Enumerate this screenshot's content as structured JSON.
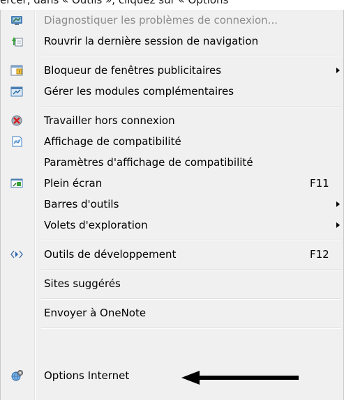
{
  "caption": "ercer, dans « Outils », cliquez sur « Options",
  "menu": {
    "items": [
      {
        "label": "Diagnostiquer les problèmes de connexion...",
        "icon": "network-diagnose-icon",
        "disabled": true
      },
      {
        "label": "Rouvrir la dernière session de navigation",
        "icon": "reopen-session-icon"
      },
      {
        "label": "Bloqueur de fenêtres publicitaires",
        "icon": "popup-blocker-icon",
        "submenu": true
      },
      {
        "label": "Gérer les modules complémentaires",
        "icon": "addons-icon"
      },
      {
        "label": "Travailler hors connexion",
        "icon": "work-offline-icon"
      },
      {
        "label": "Affichage de compatibilité",
        "icon": "compatibility-view-icon"
      },
      {
        "label": "Paramètres d'affichage de compatibilité"
      },
      {
        "label": "Plein écran",
        "icon": "fullscreen-icon",
        "shortcut": "F11"
      },
      {
        "label": "Barres d'outils",
        "submenu": true
      },
      {
        "label": "Volets d'exploration",
        "submenu": true
      },
      {
        "label": "Outils de développement",
        "icon": "developer-tools-icon",
        "shortcut": "F12"
      },
      {
        "label": "Sites suggérés"
      },
      {
        "label": "Envoyer à OneNote"
      },
      {
        "label": "Options Internet",
        "icon": "internet-options-icon"
      }
    ]
  },
  "colors": {
    "menu_background": "#f0f0f0",
    "disabled_text": "#8d8d8d",
    "annotation_arrow": "#000000"
  }
}
